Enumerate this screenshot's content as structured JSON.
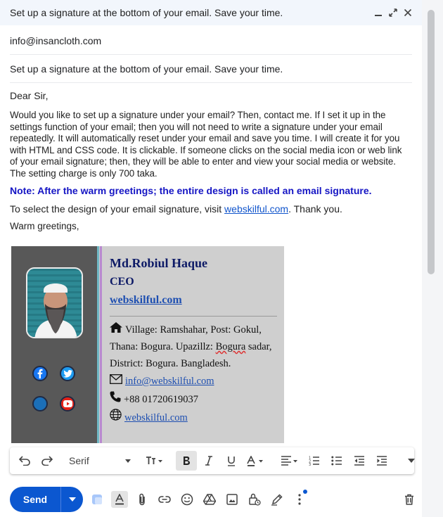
{
  "window": {
    "title": "Set up a signature at the bottom of your email. Save your time."
  },
  "from": "info@insancloth.com",
  "subject": "Set up a signature at the bottom of your email. Save your time.",
  "body": {
    "greeting": "Dear Sir,",
    "paragraph": "Would you like to set up a signature under your email? Then, contact me. If I set it up in the settings function of your email; then you will not need to write a signature under your email repeatedly. It will automatically reset under your email and save you time. I will create it for you with HTML and CSS code. It is clickable. If someone clicks on the social media icon or web link of your email signature; then, they will be able to enter and view your social media or website. The setting charge is only 700 taka.",
    "note": "Note: After the warm greetings; the entire design is called an email signature.",
    "visit_prefix": "To select the design of your email signature, visit ",
    "visit_link": "webskilful.com",
    "visit_suffix": ". Thank you.",
    "closing": "Warm greetings,"
  },
  "signature": {
    "name": "Md.Robiul Haque",
    "role": "CEO",
    "website": "webskilful.com",
    "address_1": "Village: Ramshahar, Post: Gokul,",
    "address_2a": "Thana: Bogura. Upazillz: ",
    "address_2b": "Bogura",
    "address_2c": " sadar,",
    "address_3": "District: Bogura. Bangladesh.",
    "email": "info@webskilful.com",
    "phone": "+88 01720619037",
    "web": "webskilful.com",
    "colors": {
      "left_panel": "#585858",
      "right_panel": "#cfcfcf",
      "name": "#0d1a66",
      "link": "#1e4fb1"
    }
  },
  "toolbar": {
    "font": "Serif"
  },
  "send": {
    "label": "Send"
  },
  "colors": {
    "send": "#0b57d0",
    "title_bar": "#f2f6fc"
  }
}
